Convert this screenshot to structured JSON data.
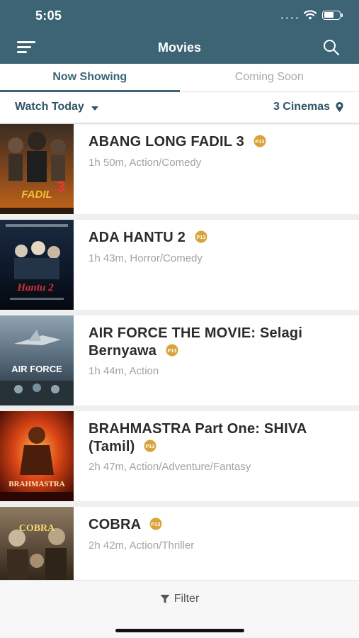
{
  "status_bar": {
    "time": "5:05"
  },
  "header": {
    "title": "Movies"
  },
  "tabs": [
    {
      "label": "Now Showing",
      "active": true
    },
    {
      "label": "Coming Soon",
      "active": false
    }
  ],
  "filters": {
    "date_label": "Watch Today",
    "cinemas_label": "3 Cinemas"
  },
  "movies": [
    {
      "title": "ABANG LONG FADIL 3",
      "meta": "1h 50m, Action/Comedy",
      "rating": "P13",
      "poster_icon": "abang-long-fadil-poster"
    },
    {
      "title": "ADA HANTU 2",
      "meta": "1h 43m, Horror/Comedy",
      "rating": "P13",
      "poster_icon": "ada-hantu-poster"
    },
    {
      "title_line1": "AIR FORCE THE MOVIE: Selagi",
      "title_line2": "Bernyawa",
      "meta": "1h 44m, Action",
      "rating": "P13",
      "poster_icon": "air-force-poster"
    },
    {
      "title_line1": "BRAHMASTRA Part One: SHIVA",
      "title_line2": "(Tamil)",
      "meta": "2h 47m, Action/Adventure/Fantasy",
      "rating": "P13",
      "poster_icon": "brahmastra-poster"
    },
    {
      "title": "COBRA",
      "meta": "2h 42m, Action/Thriller",
      "rating": "P13",
      "poster_icon": "cobra-poster"
    }
  ],
  "bottom": {
    "filter_label": "Filter"
  },
  "colors": {
    "header": "#3c6474",
    "accent": "#2f5566",
    "rating_badge": "#d9a33a"
  }
}
